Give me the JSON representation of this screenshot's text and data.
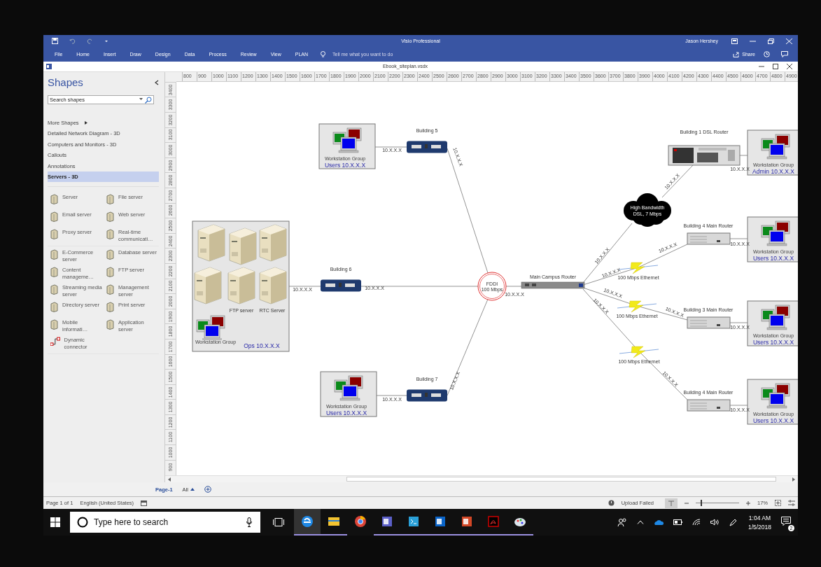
{
  "title_bar": {
    "title": "Visio Professional",
    "user": "Jason Hershey"
  },
  "ribbon_tabs": [
    "File",
    "Home",
    "Insert",
    "Draw",
    "Design",
    "Data",
    "Process",
    "Review",
    "View",
    "PLAN"
  ],
  "tell_me": "Tell me what you want to do",
  "share": "Share",
  "document": {
    "file_name": "Ebook_siteplan.vsdx"
  },
  "shapes_panel": {
    "title": "Shapes",
    "search": {
      "placeholder": "Search shapes"
    },
    "categories": [
      {
        "label": "More Shapes",
        "kind": "submenu",
        "selected": false
      },
      {
        "label": "Detailed Network Diagram - 3D",
        "kind": "stencil",
        "selected": false
      },
      {
        "label": "Computers and Monitors - 3D",
        "kind": "stencil",
        "selected": false
      },
      {
        "label": "Callouts",
        "kind": "stencil",
        "selected": false
      },
      {
        "label": "Annotations",
        "kind": "stencil",
        "selected": false
      },
      {
        "label": "Servers - 3D",
        "kind": "stencil",
        "selected": true
      }
    ],
    "stencil_sections": [
      [
        "Server",
        "File server",
        "Email server",
        "Web server",
        "Proxy server",
        "Real-time communicati…"
      ],
      [
        "E-Commerce server",
        "Database server",
        "Content manageme…",
        "FTP server",
        "Streaming media server",
        "Management server",
        "Directory server",
        "Print server",
        "Mobile informati…",
        "Application server",
        "Dynamic connector"
      ]
    ]
  },
  "ruler": {
    "horizontal": [
      "800",
      "900",
      "1000",
      "1100",
      "1200",
      "1300",
      "1400",
      "1500",
      "1600",
      "1700",
      "1800",
      "1900",
      "2000",
      "2100",
      "2200",
      "2300",
      "2400",
      "2500",
      "2600",
      "2700",
      "2800",
      "2900",
      "3000",
      "3100",
      "3200",
      "3300",
      "3400",
      "3500",
      "3600",
      "3700",
      "3800",
      "3900",
      "4000",
      "4100",
      "4200",
      "4300",
      "4400",
      "4500",
      "4600",
      "4700",
      "4800",
      "4900"
    ],
    "vertical": [
      "3400",
      "3300",
      "3200",
      "3100",
      "3000",
      "2900",
      "2800",
      "2700",
      "2600",
      "2500",
      "2400",
      "2300",
      "2200",
      "2100",
      "2000",
      "1900",
      "1800",
      "1700",
      "1600",
      "1500",
      "1400",
      "1300",
      "1200",
      "1100",
      "1000",
      "900"
    ]
  },
  "diagram": {
    "nodes": [
      {
        "kind": "workstation-group",
        "caption": "Workstation Group",
        "label": "Users 10.X.X.X"
      },
      {
        "kind": "bridge",
        "label": "Building 5"
      },
      {
        "kind": "server-group",
        "server_labels": [
          "FTP server",
          "RTC Server"
        ],
        "caption": "Workstation Group",
        "label": "Ops 10.X.X.X"
      },
      {
        "kind": "bridge",
        "label": "Building 6"
      },
      {
        "kind": "workstation-group",
        "caption": "Workstation Group",
        "label": "Users 10.X.X.X"
      },
      {
        "kind": "bridge",
        "label": "Building 7"
      },
      {
        "kind": "ring",
        "lines": [
          "FDDI",
          "100 Mbps"
        ]
      },
      {
        "kind": "router",
        "label": "Main Campus Router"
      },
      {
        "kind": "cloud",
        "lines": [
          "High Bandwidth",
          "DSL, 7 Mbps"
        ]
      },
      {
        "kind": "rack-router",
        "label": "Building 1 DSL Router"
      },
      {
        "kind": "workstation-group",
        "caption": "Workstation Group",
        "label": "Admin 10.X.X.X"
      },
      {
        "kind": "lightning",
        "label": "100 Mbps Ethernet"
      },
      {
        "kind": "lightning",
        "label": "100 Mbps Ethernet"
      },
      {
        "kind": "lightning",
        "label": "100 Mbps Ethernet"
      },
      {
        "kind": "switch",
        "label": "Building 4 Main Router"
      },
      {
        "kind": "workstation-group",
        "caption": "Workstation Group",
        "label": "Users 10.X.X.X"
      },
      {
        "kind": "switch",
        "label": "Building 3 Main Router"
      },
      {
        "kind": "workstation-group",
        "caption": "Workstation Group",
        "label": "Users 10.X.X.X"
      },
      {
        "kind": "switch",
        "label": "Building 4 Main Router"
      },
      {
        "kind": "workstation-group",
        "caption": "Workstation Group",
        "label": "Users 10.X.X.X"
      }
    ],
    "link_labels": [
      "10.X.X.X",
      "10.X.X.X",
      "10.X.X.X",
      "10.X.X.X",
      "10.X.X.X",
      "10.X.X.X",
      "10.X.X.X",
      "10.X.X.X",
      "10.X.X.X",
      "10.X.X.X",
      "10.X.X.X",
      "10.X.X.X",
      "10.X.X.X",
      "10.X.X.X",
      "10.X.X.X",
      "10.X.X.X",
      "10.X.X.X",
      "10.X.X.X",
      "10.X.X.X"
    ]
  },
  "page_tabs": [
    {
      "label": "Page-1",
      "selected": true
    }
  ],
  "all_pages": "All",
  "status_bar": {
    "page": "Page 1 of 1",
    "language": "English (United States)",
    "upload": "Upload Failed",
    "zoom": {
      "level": 0.12,
      "reading": "17%"
    }
  },
  "taskbar": {
    "search": {
      "placeholder": "Type here to search"
    },
    "apps": [
      {
        "kind": "edge",
        "running": true,
        "active": true
      },
      {
        "kind": "file-explorer",
        "running": true,
        "active": false
      },
      {
        "kind": "chrome",
        "running": false,
        "active": false
      },
      {
        "kind": "teams",
        "running": true,
        "active": false
      },
      {
        "kind": "terminal",
        "running": true,
        "active": false
      },
      {
        "kind": "outlook",
        "running": true,
        "active": false
      },
      {
        "kind": "powerpoint",
        "running": true,
        "active": false
      },
      {
        "kind": "acrobat",
        "running": true,
        "active": false
      },
      {
        "kind": "paint",
        "running": true,
        "active": false
      }
    ],
    "time": "1:04 AM",
    "date": "1/5/2018",
    "notifications": "2"
  }
}
